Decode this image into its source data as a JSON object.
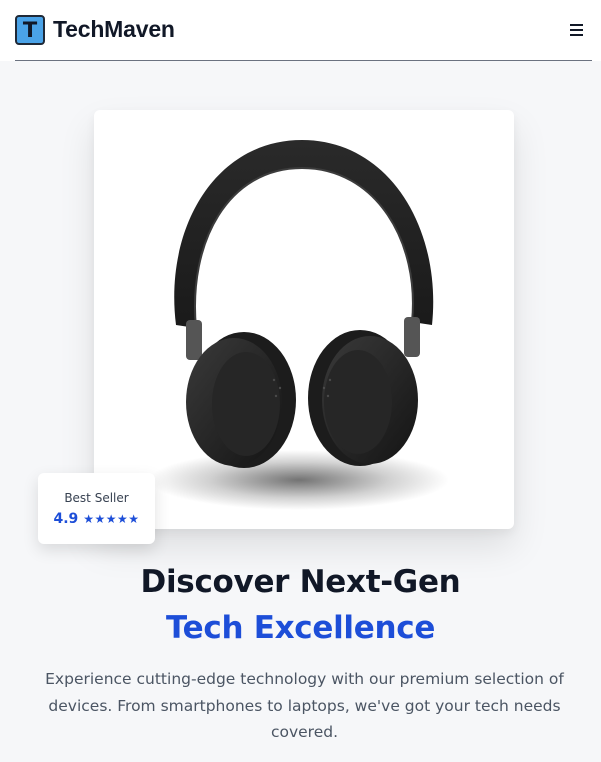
{
  "header": {
    "logo_letter": "T",
    "brand_name": "TechMaven",
    "menu_icon": "hamburger-menu-icon"
  },
  "hero": {
    "image_subject": "headphones-image",
    "badge": {
      "label": "Best Seller",
      "rating": "4.9",
      "stars": "★★★★★"
    },
    "headline_line1": "Discover Next-Gen",
    "headline_line2": "Tech Excellence",
    "description": "Experience cutting-edge technology with our premium selection of devices. From smartphones to laptops, we've got your tech needs covered."
  },
  "colors": {
    "accent": "#1d4ed8",
    "logo_bg": "#4aa3e8",
    "background": "#f6f7f9"
  }
}
